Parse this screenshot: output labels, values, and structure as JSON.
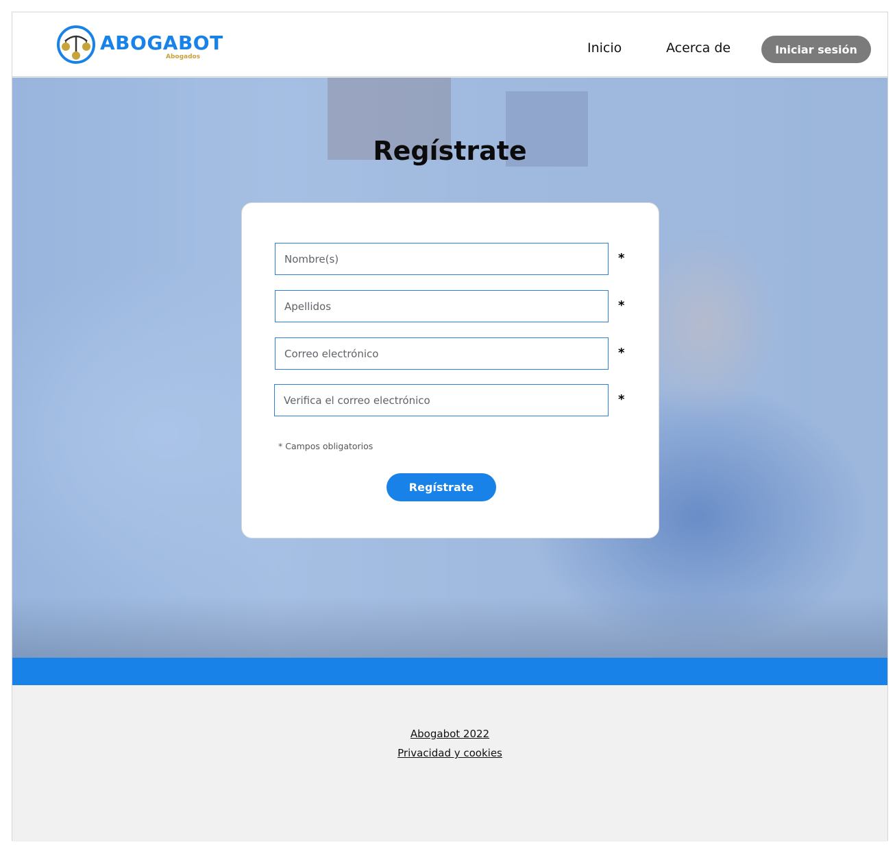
{
  "brand": {
    "name": "ABOGABOT",
    "tagline": "Abogados",
    "primary_color": "#1882e8",
    "accent_color": "#c8a23a"
  },
  "nav": {
    "items": [
      {
        "label": "Inicio"
      },
      {
        "label": "Acerca de"
      }
    ],
    "login_label": "Iniciar sesión"
  },
  "hero": {
    "title": "Regístrate"
  },
  "form": {
    "fields": [
      {
        "placeholder": "Nombre(s)",
        "value": "",
        "required_mark": "*"
      },
      {
        "placeholder": "Apellidos",
        "value": "",
        "required_mark": "*"
      },
      {
        "placeholder": "Correo electrónico",
        "value": "",
        "required_mark": "*"
      },
      {
        "placeholder": "Verifica el correo electrónico",
        "value": "",
        "required_mark": "*"
      }
    ],
    "required_note": "* Campos obligatorios",
    "submit_label": "Regístrate"
  },
  "footer": {
    "copyright": "Abogabot 2022",
    "privacy": "Privacidad y cookies"
  }
}
